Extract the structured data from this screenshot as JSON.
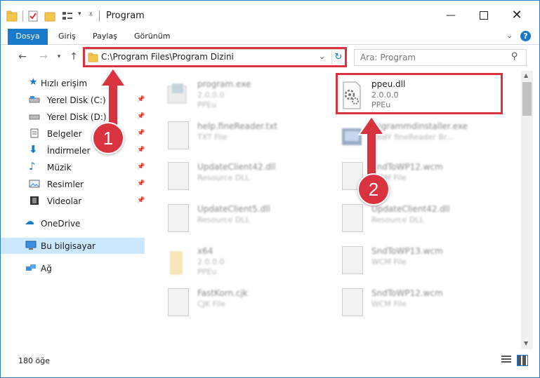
{
  "window": {
    "title": "Program"
  },
  "ribbon": {
    "tabs": [
      {
        "label": "Dosya",
        "active": true
      },
      {
        "label": "Giriş"
      },
      {
        "label": "Paylaş"
      },
      {
        "label": "Görünüm"
      }
    ]
  },
  "nav": {
    "address": "C:\\Program Files\\Program Dizini",
    "search_placeholder": "Ara: Program"
  },
  "sidebar": {
    "items": [
      {
        "label": "Hızlı erişim",
        "icon": "star-icon"
      },
      {
        "label": "Yerel Disk (C:)",
        "icon": "drive-icon",
        "pinned": true
      },
      {
        "label": "Yerel Disk (D:)",
        "icon": "drive-icon",
        "pinned": true
      },
      {
        "label": "Belgeler",
        "icon": "documents-icon",
        "pinned": true
      },
      {
        "label": "İndirmeler",
        "icon": "download-icon",
        "pinned": true
      },
      {
        "label": "Müzik",
        "icon": "music-icon",
        "pinned": true
      },
      {
        "label": "Resimler",
        "icon": "pictures-icon",
        "pinned": true
      },
      {
        "label": "Videolar",
        "icon": "videos-icon",
        "pinned": true
      },
      {
        "label": "OneDrive",
        "icon": "cloud-icon"
      },
      {
        "label": "Bu bilgisayar",
        "icon": "computer-icon",
        "selected": true
      },
      {
        "label": "Ağ",
        "icon": "network-icon"
      }
    ]
  },
  "files": [
    {
      "name": "program.exe",
      "meta1": "2.0.0.0",
      "meta2": "PPEu"
    },
    {
      "name": "ppeu.dll",
      "meta1": "2.0.0.0",
      "meta2": "PPEu"
    },
    {
      "name": "help.fineReader.txt",
      "meta1": "TXT File",
      "meta2": ""
    },
    {
      "name": "Trigrammdinstaller.exe",
      "meta1": "ABBY fineReader Br...",
      "meta2": ""
    },
    {
      "name": "UpdateClient42.dll",
      "meta1": "Resource DLL",
      "meta2": ""
    },
    {
      "name": "SndToWP12.wcm",
      "meta1": "WCM File",
      "meta2": ""
    },
    {
      "name": "UpdateClient5.dll",
      "meta1": "Resource DLL",
      "meta2": ""
    },
    {
      "name": "UpdateClient42.dll",
      "meta1": "Resource DLL",
      "meta2": ""
    },
    {
      "name": "x64",
      "meta1": "2.0.0.0",
      "meta2": "PPEu"
    },
    {
      "name": "SndToWP13.wcm",
      "meta1": "WCM File",
      "meta2": ""
    },
    {
      "name": "FastKorn.cjk",
      "meta1": "CJK File",
      "meta2": ""
    },
    {
      "name": "SndToWP12.wcm",
      "meta1": "WCM File",
      "meta2": ""
    }
  ],
  "status": {
    "count": "180 öğe"
  },
  "callouts": {
    "one": "1",
    "two": "2"
  },
  "colors": {
    "accent": "#1979ca",
    "highlight": "#d9333f",
    "selected_bg": "#cce8ff"
  }
}
